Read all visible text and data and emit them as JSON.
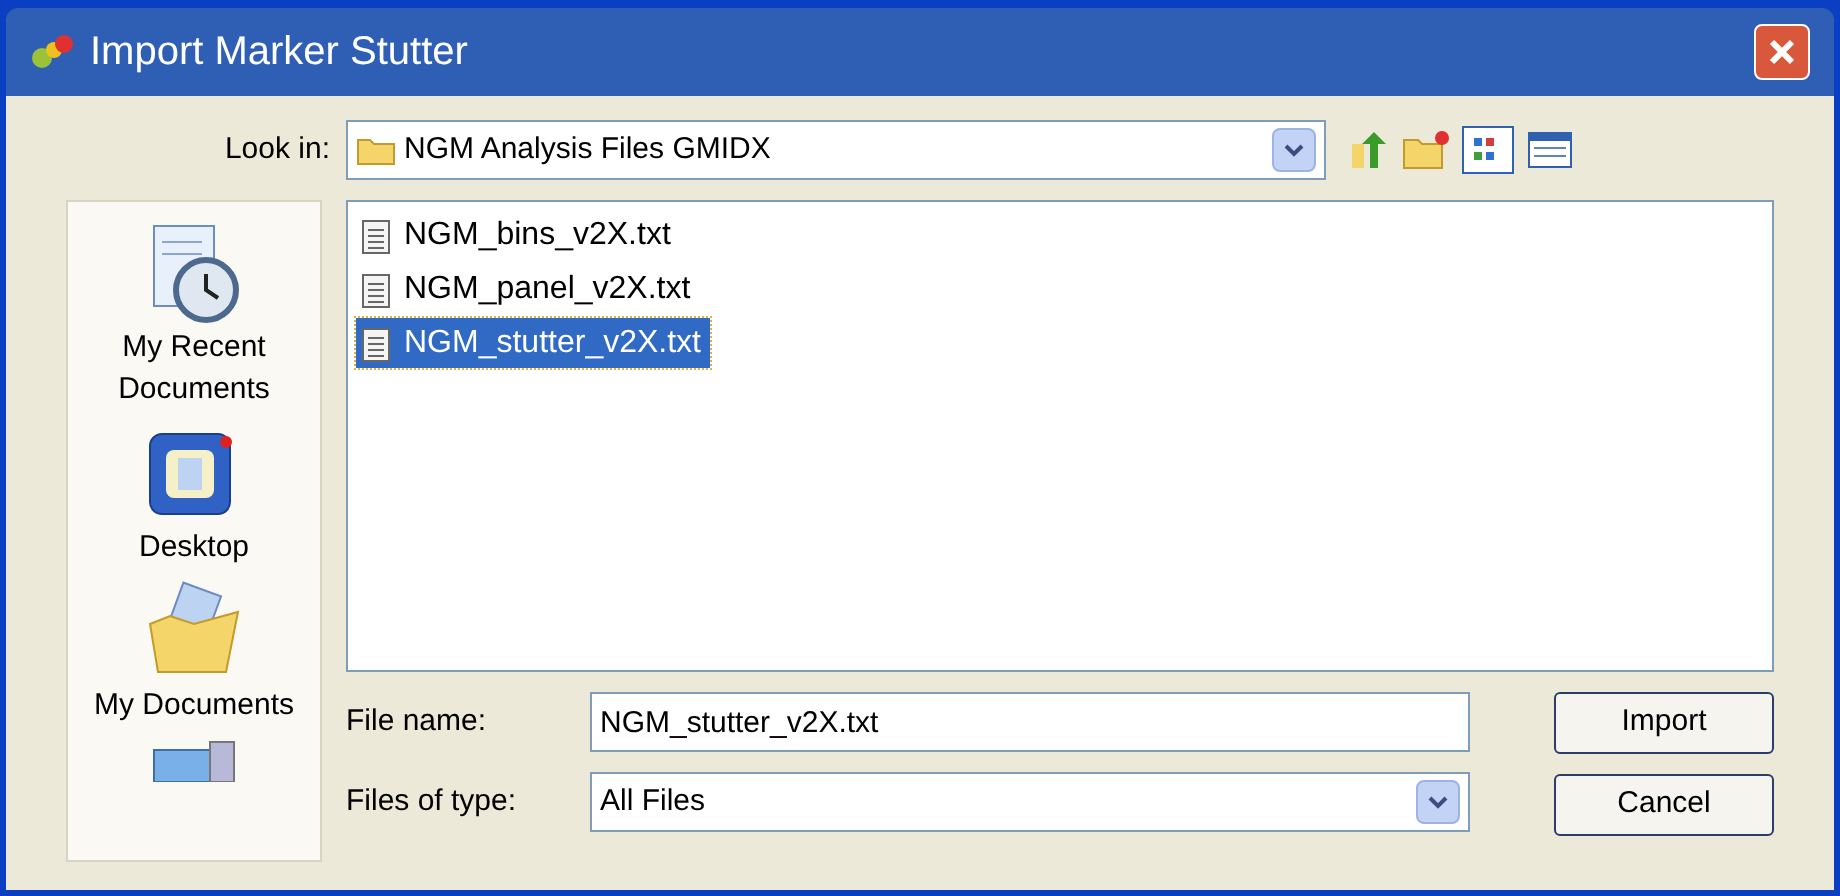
{
  "window": {
    "title": "Import Marker Stutter"
  },
  "look_in": {
    "label": "Look in:",
    "value": "NGM Analysis Files GMIDX"
  },
  "places": [
    {
      "label": "My Recent Documents",
      "kind": "recent"
    },
    {
      "label": "Desktop",
      "kind": "desktop"
    },
    {
      "label": "My Documents",
      "kind": "documents"
    },
    {
      "kind": "computer"
    }
  ],
  "files": [
    {
      "name": "NGM_bins_v2X.txt",
      "selected": false
    },
    {
      "name": "NGM_panel_v2X.txt",
      "selected": false
    },
    {
      "name": "NGM_stutter_v2X.txt",
      "selected": true
    }
  ],
  "file_name": {
    "label": "File name:",
    "value": "NGM_stutter_v2X.txt"
  },
  "file_type": {
    "label": "Files of type:",
    "value": "All Files"
  },
  "buttons": [
    "Import",
    "Cancel"
  ]
}
